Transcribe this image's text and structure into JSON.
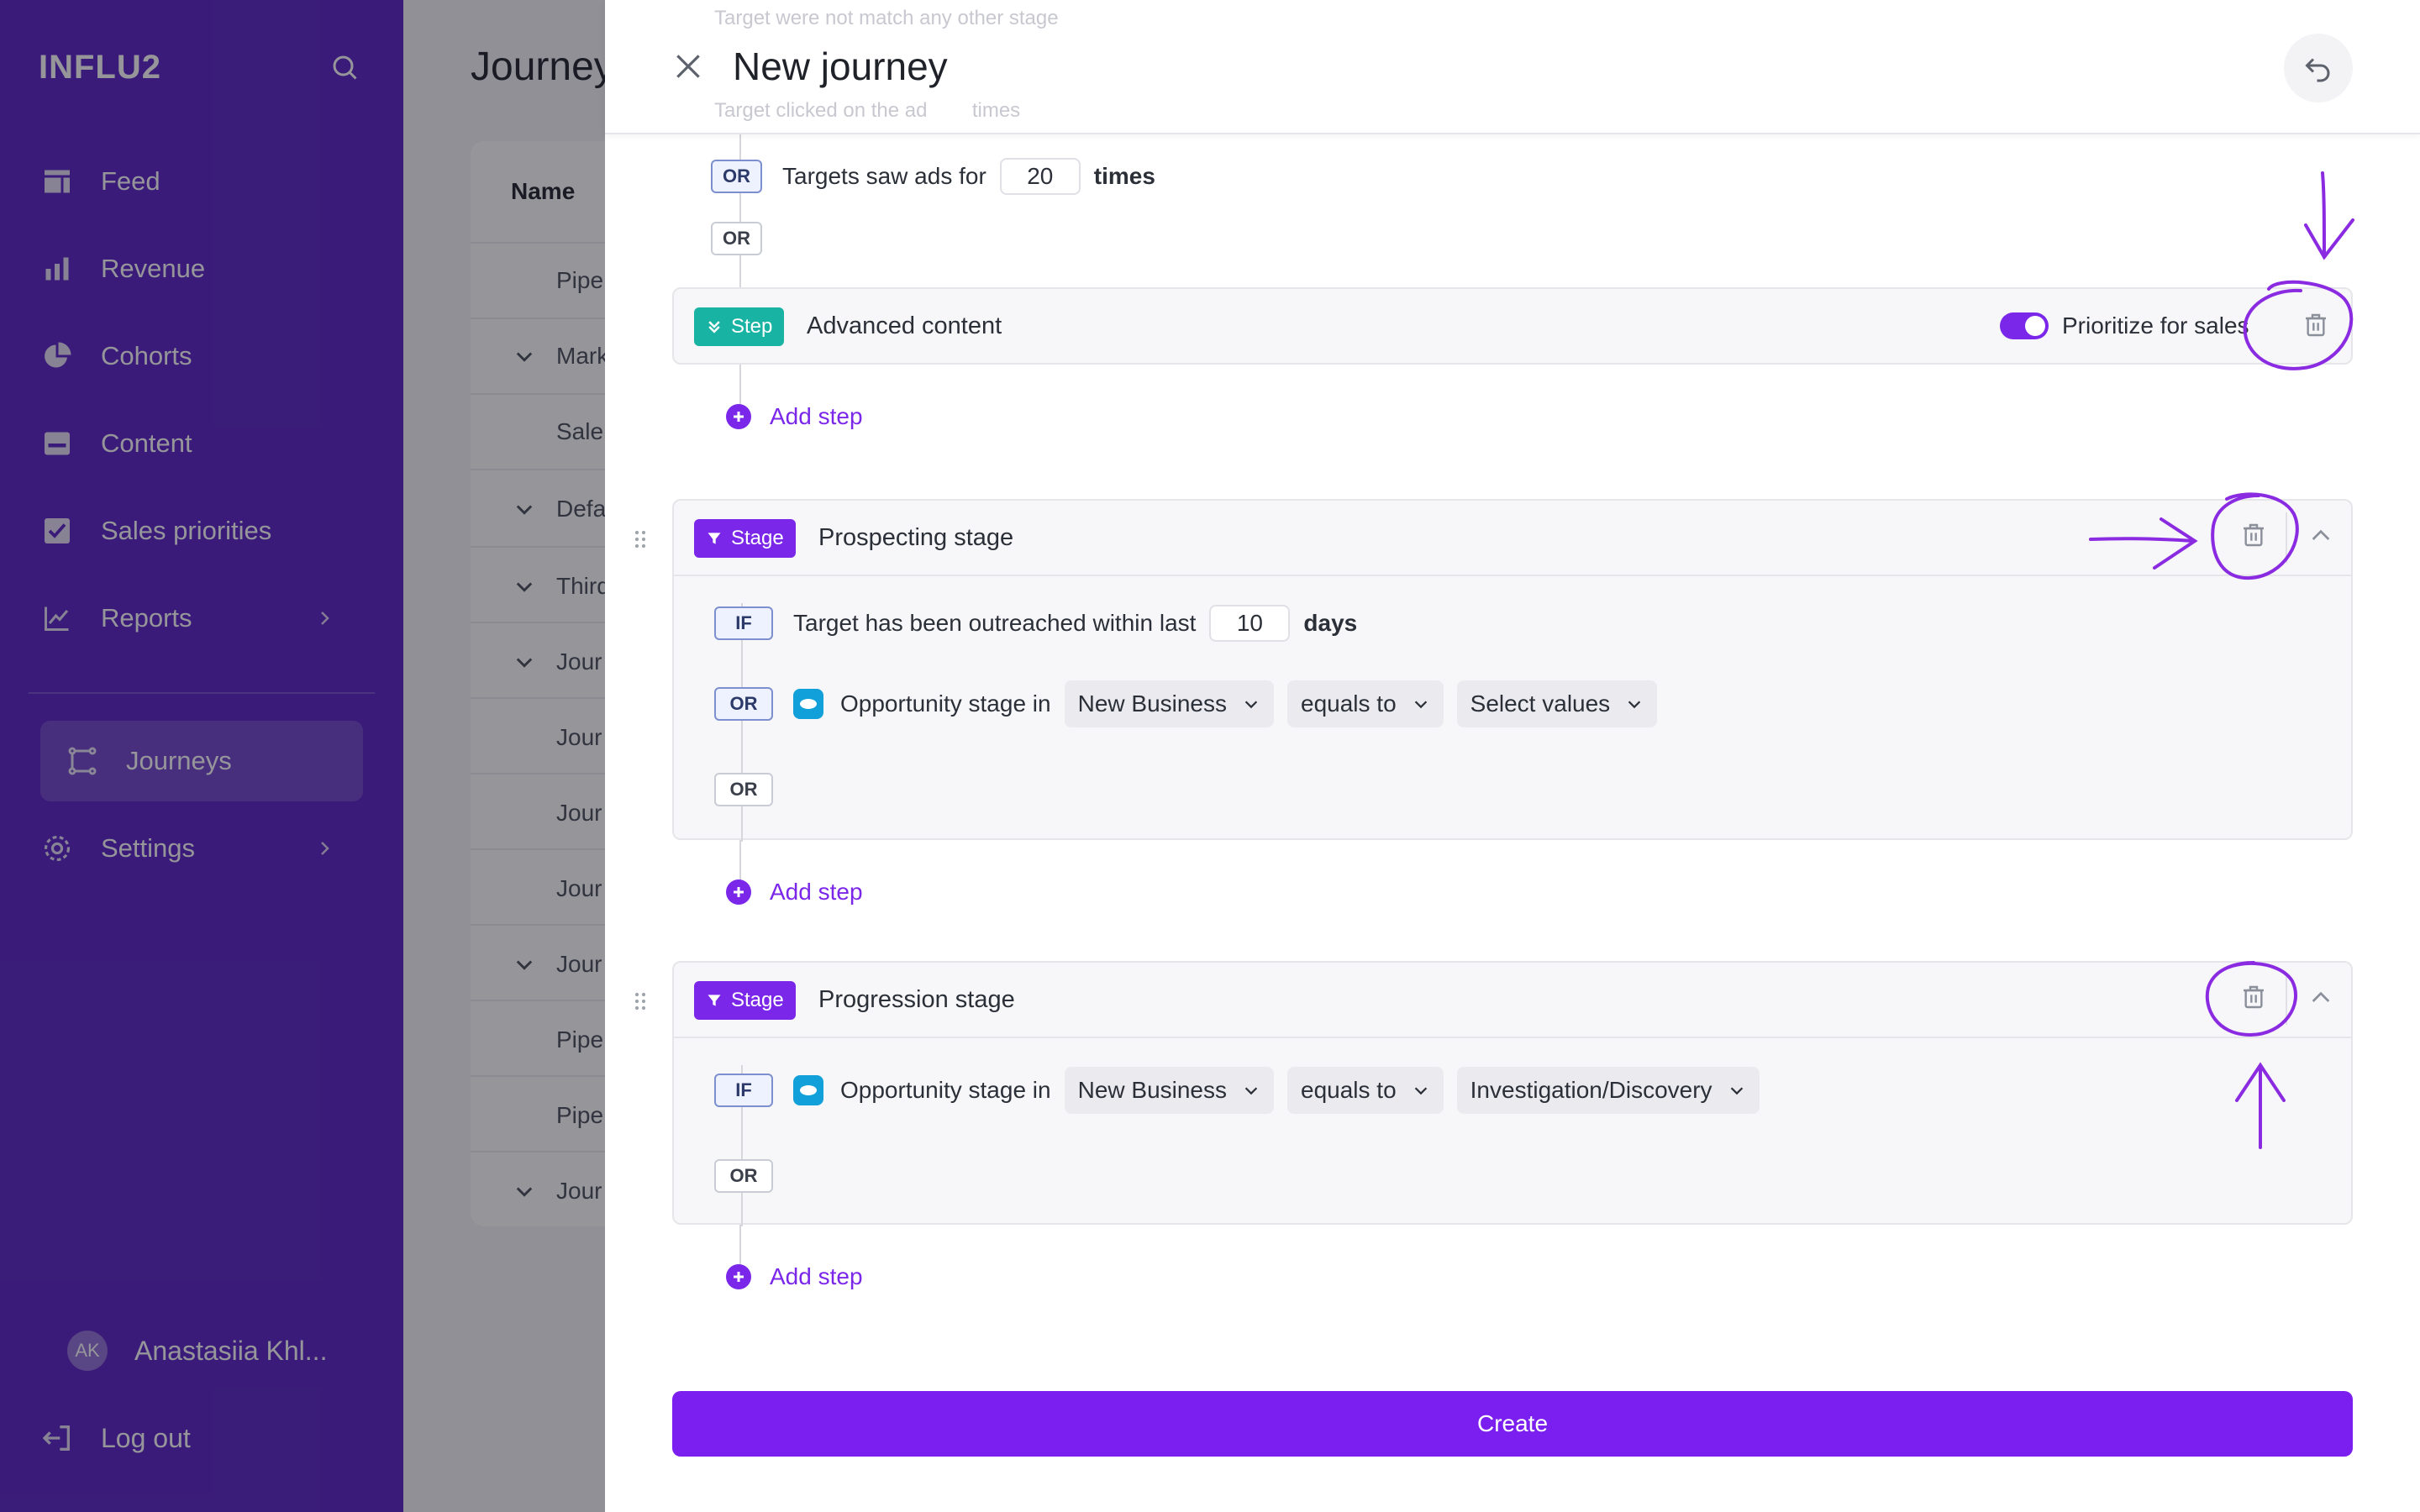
{
  "sidebar": {
    "logo": "INFLU2",
    "items": [
      {
        "label": "Feed"
      },
      {
        "label": "Revenue"
      },
      {
        "label": "Cohorts"
      },
      {
        "label": "Content"
      },
      {
        "label": "Sales priorities"
      },
      {
        "label": "Reports"
      },
      {
        "label": "Journeys"
      },
      {
        "label": "Settings"
      }
    ],
    "user": {
      "initials": "AK",
      "name": "Anastasiia Khl..."
    },
    "logout_label": "Log out"
  },
  "background": {
    "title": "Journey",
    "column_header": "Name",
    "rows": [
      "Pipe",
      "Mark",
      "Sale",
      "Defa",
      "Third",
      "Jour",
      "Jour",
      "Jour",
      "Jour",
      "Jour",
      "Pipe",
      "Pipe",
      "Jour"
    ]
  },
  "modal": {
    "title": "New journey",
    "ghost_line": "Target were not match any other stage",
    "ghost_line2": "Target clicked on the ad",
    "ghost_times": "times",
    "top_condition": {
      "badge": "OR",
      "text": "Targets saw ads for",
      "value": "20",
      "unit": "times"
    },
    "or_label": "OR",
    "step": {
      "pill": "Step",
      "title": "Advanced content",
      "toggle_label": "Prioritize for sales"
    },
    "add_step_label": "Add step",
    "stage1": {
      "pill": "Stage",
      "title": "Prospecting stage",
      "if_badge": "IF",
      "if_text": "Target has been outreached within last",
      "if_value": "10",
      "if_unit": "days",
      "or_badge": "OR",
      "opp_text": "Opportunity stage in",
      "select1": "New Business",
      "select2": "equals to",
      "select3": "Select values",
      "or_end": "OR"
    },
    "stage2": {
      "pill": "Stage",
      "title": "Progression stage",
      "if_badge": "IF",
      "opp_text": "Opportunity stage in",
      "select1": "New Business",
      "select2": "equals to",
      "select3": "Investigation/Discovery",
      "or_end": "OR"
    },
    "create_label": "Create"
  },
  "colors": {
    "sidebar": "#5a22c4",
    "accent": "#7b27ea",
    "step": "#19b3a3",
    "annotation": "#8a2be2"
  }
}
